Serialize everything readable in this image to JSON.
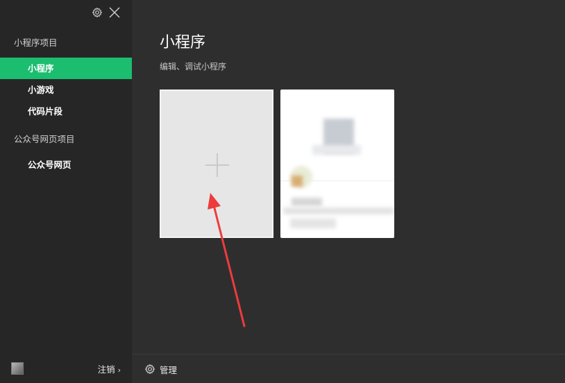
{
  "sidebar": {
    "section_mini_title": "小程序项目",
    "items": [
      {
        "label": "小程序",
        "active": true
      },
      {
        "label": "小游戏",
        "active": false
      },
      {
        "label": "代码片段",
        "active": false
      }
    ],
    "section_web_title": "公众号网页项目",
    "web_items": [
      {
        "label": "公众号网页",
        "active": false
      }
    ],
    "logout_label": "注销",
    "icons": [
      "gear-icon",
      "close-icon",
      "chevron-right-icon"
    ]
  },
  "main": {
    "title": "小程序",
    "subtitle": "编辑、调试小程序",
    "footer": {
      "manage_label": "管理",
      "icon": "gear-icon"
    }
  },
  "colors": {
    "accent": "#1bbd6f",
    "sidebar_bg": "#262626",
    "main_bg": "#2e2e2f",
    "arrow": "#ee3b3b"
  }
}
